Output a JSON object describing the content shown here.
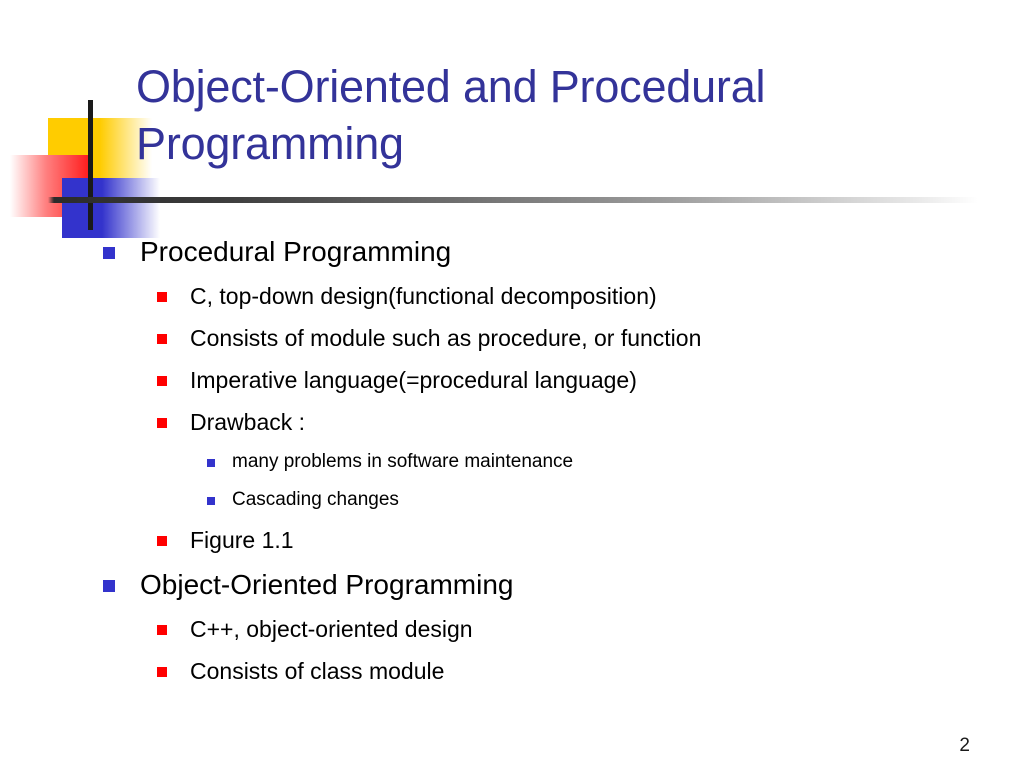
{
  "slide": {
    "title": "Object-Oriented and Procedural Programming",
    "page_number": "2",
    "colors": {
      "title": "#333399",
      "bullet_level1": "#3333CC",
      "bullet_level2": "#FF0000",
      "bullet_level3": "#3333CC",
      "body_text": "#000000",
      "logo_yellow": "#FFCC00",
      "logo_red": "#FF1A1A",
      "logo_blue": "#3333CC",
      "background": "#FFFFFF"
    },
    "bullets": [
      {
        "level": 1,
        "text": "Procedural Programming"
      },
      {
        "level": 2,
        "text": "C, top-down design(functional decomposition)"
      },
      {
        "level": 2,
        "text": "Consists of module such as procedure, or function"
      },
      {
        "level": 2,
        "text": "Imperative language(=procedural language)"
      },
      {
        "level": 2,
        "text": "Drawback :"
      },
      {
        "level": 3,
        "text": "many problems in software maintenance"
      },
      {
        "level": 3,
        "text": "Cascading changes"
      },
      {
        "level": 2,
        "text": "Figure 1.1"
      },
      {
        "level": 1,
        "text": "Object-Oriented Programming"
      },
      {
        "level": 2,
        "text": "C++, object-oriented design"
      },
      {
        "level": 2,
        "text": "Consists of class module"
      }
    ]
  }
}
